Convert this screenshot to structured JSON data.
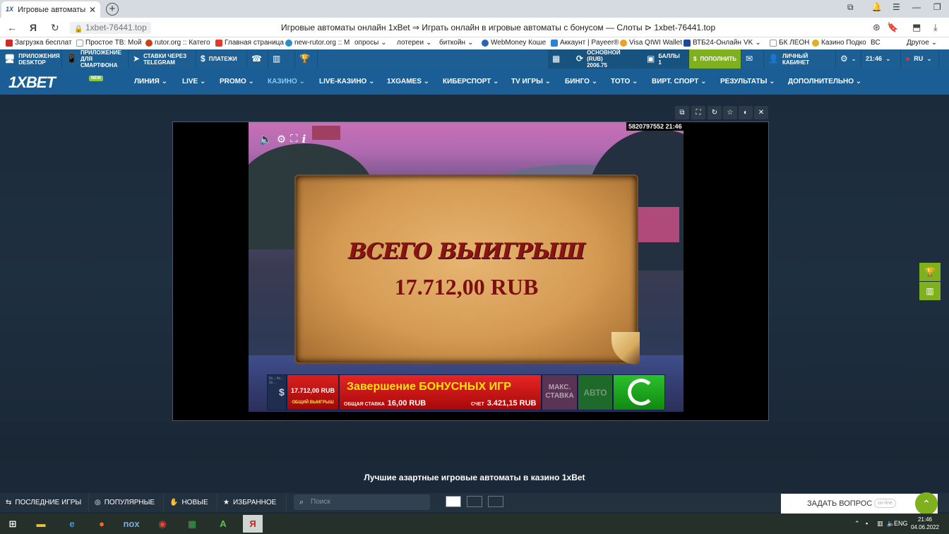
{
  "browser": {
    "tab_title": "Игровые автоматы с",
    "url": "1xbet-76441.top",
    "page_title": "Игровые автоматы онлайн 1xBet ⇒ Играть онлайн в игровые автоматы с бонусом — Слоты ⊳ 1xbet-76441.top",
    "bookmarks": [
      "Загрузка бесплат",
      "Простое ТВ: Мой",
      "rutor.org :: Катего",
      "Главная страница",
      "new-rutor.org :: М",
      "опросы",
      "лотереи",
      "биткойн",
      "WebMoney Коше",
      "Аккаунт | Payeer®",
      "Visa QIWI Wallet",
      "ВТБ24-Онлайн",
      "VK",
      "БК ЛЕОН",
      "Казино Подко",
      "ВС",
      "Другое"
    ]
  },
  "topbar": {
    "apps_desktop": "Приложения DESKTOP",
    "apps_smartphone": "Приложение для смартфона",
    "telegram": "Ставки через TELEGRAM",
    "payments": "Платежи",
    "balance_label": "Основной (RUB)",
    "balance_value": "2006.75",
    "points_label": "Баллы",
    "points_value": "1",
    "deposit": "Пополнить",
    "cabinet": "Личный кабинет",
    "time": "21:46",
    "lang": "RU"
  },
  "nav": {
    "logo": "1XBET",
    "new_badge": "NEW",
    "items": [
      "ЛИНИЯ",
      "LIVE",
      "PROMO",
      "КАЗИНО",
      "LIVE-КАЗИНО",
      "1XGAMES",
      "КИБЕРСПОРТ",
      "TV ИГРЫ",
      "БИНГО",
      "ТОТО",
      "ВИРТ. СПОРТ",
      "РЕЗУЛЬТАТЫ",
      "ДОПОЛНИТЕЛЬНО"
    ]
  },
  "game": {
    "session_id": "5820797552 21:46",
    "win_title": "ВСЕГО ВЫИГРЫШ",
    "win_amount": "17.712,00 RUB",
    "total_win_value": "17.712,00 RUB",
    "total_win_label": "ОБЩИЙ ВЫИГРЫШ",
    "message": "Завершение БОНУСНЫХ ИГР",
    "stake_label": "ОБЩАЯ СТАВКА",
    "stake_value": "16,00 RUB",
    "account_label": "СЧЕТ",
    "account_value": "3.421,15 RUB",
    "max_bet": "МАКС. СТАВКА",
    "auto": "АВТО",
    "bet_levels": "5x... 4x... 3x..."
  },
  "bottom": {
    "best_title": "Лучшие азартные игровые автоматы в казино 1xBet",
    "recent": "ПОСЛЕДНИЕ ИГРЫ",
    "popular": "ПОПУЛЯРНЫЕ",
    "new": "НОВЫЕ",
    "favorites": "ИЗБРАННОЕ",
    "search_placeholder": "Поиск",
    "ask": "ЗАДАТЬ ВОПРОС",
    "online": "on-line"
  },
  "taskbar": {
    "lang": "ENG",
    "time": "21:46",
    "date": "04.06.2022"
  }
}
